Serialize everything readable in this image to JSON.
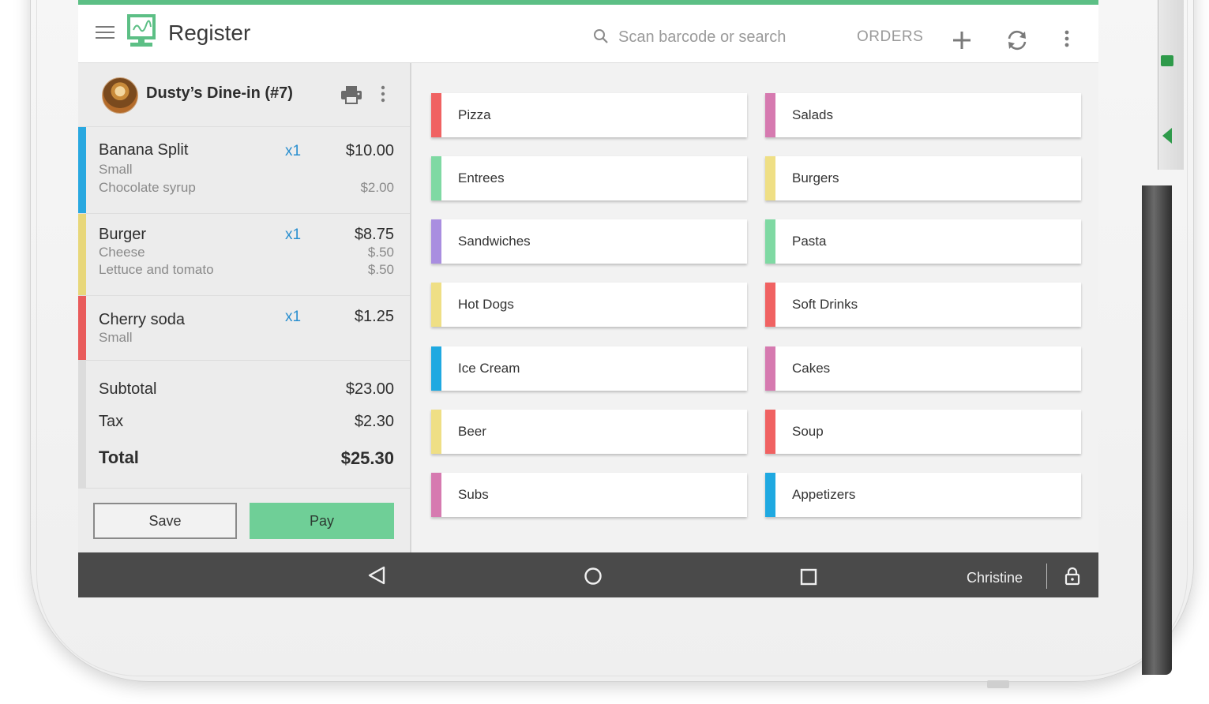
{
  "appbar": {
    "title": "Register",
    "search_placeholder": "Scan barcode or search",
    "orders_label": "ORDERS",
    "accent": "#5cbf85"
  },
  "order": {
    "name": "Dusty’s Dine-in (#7)",
    "items": [
      {
        "name": "Banana Split",
        "qty": "x1",
        "price": "$10.00",
        "color": "#29a8e0",
        "modifiers": [
          {
            "name": "Small",
            "price": ""
          },
          {
            "name": "Chocolate syrup",
            "price": "$2.00"
          }
        ]
      },
      {
        "name": "Burger",
        "qty": "x1",
        "price": "$8.75",
        "color": "#e8d77a",
        "modifiers": [
          {
            "name": "Cheese",
            "price": "$.50"
          },
          {
            "name": "Lettuce and tomato",
            "price": "$.50"
          }
        ]
      },
      {
        "name": "Cherry soda",
        "qty": "x1",
        "price": "$1.25",
        "color": "#e95b5b",
        "modifiers": [
          {
            "name": "Small",
            "price": ""
          }
        ]
      }
    ],
    "subtotal_label": "Subtotal",
    "subtotal": "$23.00",
    "tax_label": "Tax",
    "tax": "$2.30",
    "total_label": "Total",
    "total": "$25.30",
    "save_label": "Save",
    "pay_label": "Pay"
  },
  "categories": [
    {
      "label": "Pizza",
      "color": "#f06262"
    },
    {
      "label": "Salads",
      "color": "#d67ab0"
    },
    {
      "label": "Entrees",
      "color": "#7fd9a3"
    },
    {
      "label": "Burgers",
      "color": "#efdf85"
    },
    {
      "label": "Sandwiches",
      "color": "#a98ee0"
    },
    {
      "label": "Pasta",
      "color": "#7fd9a3"
    },
    {
      "label": "Hot Dogs",
      "color": "#efdf85"
    },
    {
      "label": "Soft Drinks",
      "color": "#f06262"
    },
    {
      "label": "Ice Cream",
      "color": "#1fa9e1"
    },
    {
      "label": "Cakes",
      "color": "#d67ab0"
    },
    {
      "label": "Beer",
      "color": "#efdf85"
    },
    {
      "label": "Soup",
      "color": "#f06262"
    },
    {
      "label": "Subs",
      "color": "#d67ab0"
    },
    {
      "label": "Appetizers",
      "color": "#1fa9e1"
    }
  ],
  "navbar": {
    "user": "Christine"
  }
}
